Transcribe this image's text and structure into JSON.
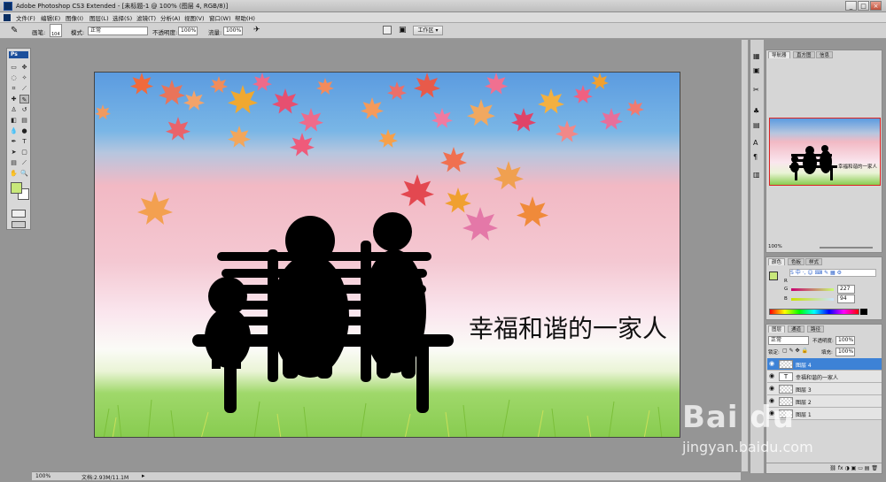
{
  "window": {
    "title": "Adobe Photoshop CS3 Extended - [未标题-1 @ 100% (图层 4, RGB/8)]",
    "min": "_",
    "max": "□",
    "close": "×"
  },
  "menu": [
    "文件(F)",
    "编辑(E)",
    "图像(I)",
    "图层(L)",
    "选择(S)",
    "滤镜(T)",
    "分析(A)",
    "视图(V)",
    "窗口(W)",
    "帮助(H)"
  ],
  "options": {
    "brush_label": "画笔:",
    "brush_size": "104",
    "mode_label": "模式:",
    "mode_value": "正常",
    "opacity_label": "不透明度:",
    "opacity_value": "100%",
    "flow_label": "流量:",
    "flow_value": "100%",
    "workspace": "工作区 ▾"
  },
  "toolbox": {
    "ps_logo": "Ps"
  },
  "canvas": {
    "caption": "幸福和谐的一家人"
  },
  "status": {
    "zoom": "100%",
    "doc": "文档:2.93M/11.1M"
  },
  "navigator": {
    "tabs": [
      "导航器",
      "直方图",
      "信息"
    ],
    "zoom": "100%",
    "preview_caption": "幸福和谐的一家人"
  },
  "color": {
    "tabs": [
      "颜色",
      "色板",
      "样式"
    ],
    "r_label": "R",
    "g_label": "G",
    "b_label": "B",
    "r": "",
    "g": "227",
    "b": "94",
    "fg": "#c8e87a",
    "bg": "#ffffff"
  },
  "layers": {
    "tabs": [
      "图层",
      "通道",
      "路径"
    ],
    "blend": "正常",
    "opacity_label": "不透明度:",
    "opacity": "100%",
    "lock_label": "锁定:",
    "fill_label": "填充:",
    "fill": "100%",
    "items": [
      {
        "name": "图层 4",
        "selected": true,
        "type": "pixel"
      },
      {
        "name": "幸福和谐的一家人",
        "selected": false,
        "type": "text"
      },
      {
        "name": "图层 3",
        "selected": false,
        "type": "pixel"
      },
      {
        "name": "图层 2",
        "selected": false,
        "type": "pixel"
      },
      {
        "name": "图层 1",
        "selected": false,
        "type": "pixel"
      }
    ]
  },
  "watermark": {
    "brand": "Bai du",
    "url": "jingyan.baidu.com"
  }
}
